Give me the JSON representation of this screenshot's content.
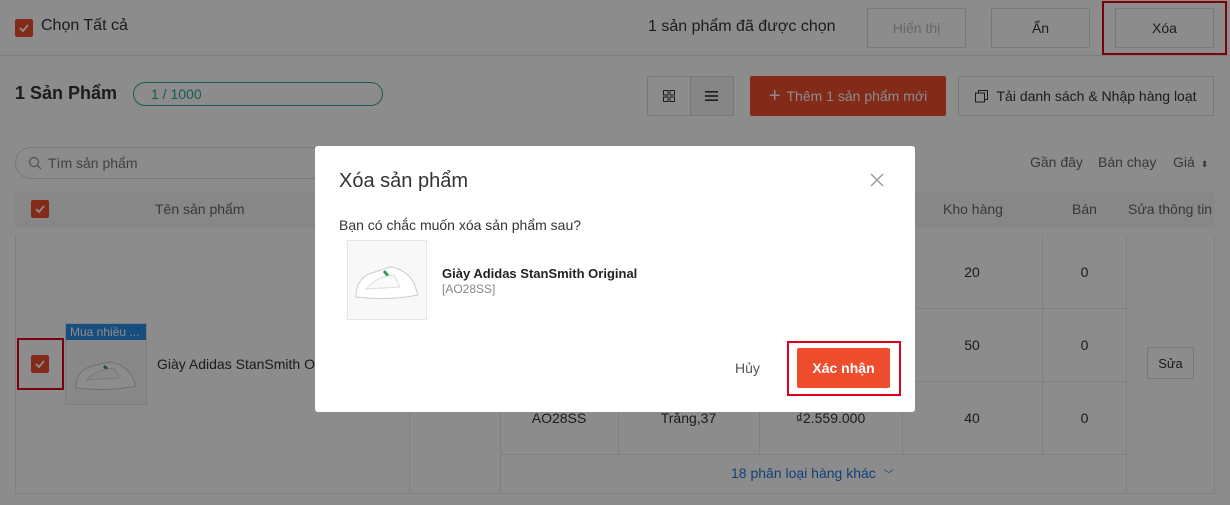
{
  "topbar": {
    "select_all_label": "Chọn Tất cả",
    "selected_status": "1 sản phẩm đã được chọn",
    "show_label": "Hiển thị",
    "hide_label": "Ẩn",
    "delete_label": "Xóa"
  },
  "header": {
    "count_title": "1 Sản Phẩm",
    "quota": "1 / 1000",
    "add_label": "Thêm 1 sản phẩm mới",
    "bulk_label": "Tải danh sách & Nhập hàng loạt"
  },
  "filters": {
    "search_placeholder": "Tìm sản phẩm",
    "sort_recent": "Gần đây",
    "sort_bestselling": "Bán chạy",
    "sort_price": "Giá"
  },
  "table": {
    "col_name": "Tên sản phẩm",
    "col_stock": "Kho hàng",
    "col_sold": "Bán",
    "col_edit": "Sửa thông tin",
    "product": {
      "badge": "Mua nhiều ...",
      "name": "Giày Adidas StanSmith Original"
    },
    "rows": [
      {
        "sku": "",
        "variant": "",
        "price": "",
        "stock": "20",
        "sold": "0"
      },
      {
        "sku": "",
        "variant": "",
        "price": "",
        "stock": "50",
        "sold": "0"
      },
      {
        "sku": "AO28SS",
        "variant": "Trắng,37",
        "price": "₫2.559.000",
        "stock": "40",
        "sold": "0"
      }
    ],
    "edit_label": "Sửa",
    "more_variants": "18 phân loại hàng khác"
  },
  "modal": {
    "title": "Xóa sản phẩm",
    "question": "Bạn có chắc muốn xóa sản phẩm sau?",
    "product_name": "Giày Adidas StanSmith Original",
    "product_sku": "[AO28SS]",
    "cancel_label": "Hủy",
    "confirm_label": "Xác nhận"
  },
  "colors": {
    "accent": "#ee4d2d",
    "highlight": "#e0001b",
    "quota_green": "#26aa99",
    "link_blue": "#2673dd"
  }
}
